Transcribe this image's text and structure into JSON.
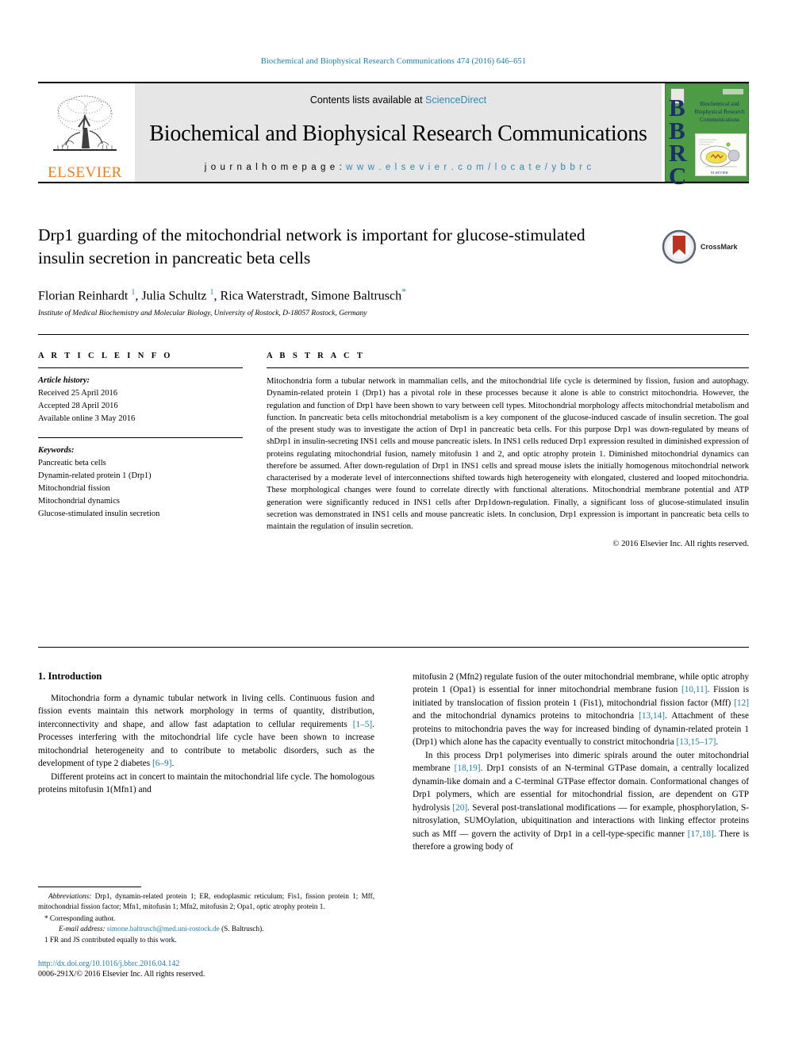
{
  "running_head": "Biochemical and Biophysical Research Communications 474 (2016) 646–651",
  "masthead": {
    "publisher": "ELSEVIER",
    "contents_prefix": "Contents lists available at ",
    "contents_link": "ScienceDirect",
    "journal_title": "Biochemical and Biophysical Research Communications",
    "homepage_prefix": "j o u r n a l  h o m e p a g e :  ",
    "homepage_url": "w w w . e l s e v i e r . c o m / l o c a t e / y b b r c",
    "cover": {
      "acronym": "BBRC",
      "title": "Biochemical and Biophysical Research Communications",
      "footer": "ELSEVIER"
    }
  },
  "article": {
    "title": "Drp1 guarding of the mitochondrial network is important for glucose-stimulated insulin secretion in pancreatic beta cells",
    "authors_html": "Florian Reinhardt, Julia Schultz, Rica Waterstradt, Simone Baltrusch",
    "author_list": [
      {
        "name": "Florian Reinhardt",
        "marks": [
          "1"
        ]
      },
      {
        "name": "Julia Schultz",
        "marks": [
          "1"
        ]
      },
      {
        "name": "Rica Waterstradt",
        "marks": []
      },
      {
        "name": "Simone Baltrusch",
        "marks": [
          "*"
        ]
      }
    ],
    "affiliation": "Institute of Medical Biochemistry and Molecular Biology, University of Rostock, D-18057 Rostock, Germany",
    "crossmark_label": "CrossMark"
  },
  "article_info": {
    "heading": "A R T I C L E   I N F O",
    "history_label": "Article history:",
    "history": [
      "Received 25 April 2016",
      "Accepted 28 April 2016",
      "Available online 3 May 2016"
    ],
    "keywords_label": "Keywords:",
    "keywords": [
      "Pancreatic beta cells",
      "Dynamin-related protein 1 (Drp1)",
      "Mitochondrial fission",
      "Mitochondrial dynamics",
      "Glucose-stimulated insulin secretion"
    ]
  },
  "abstract": {
    "heading": "A B S T R A C T",
    "text": "Mitochondria form a tubular network in mammalian cells, and the mitochondrial life cycle is determined by fission, fusion and autophagy. Dynamin-related protein 1 (Drp1) has a pivotal role in these processes because it alone is able to constrict mitochondria. However, the regulation and function of Drp1 have been shown to vary between cell types. Mitochondrial morphology affects mitochondrial metabolism and function. In pancreatic beta cells mitochondrial metabolism is a key component of the glucose-induced cascade of insulin secretion. The goal of the present study was to investigate the action of Drp1 in pancreatic beta cells. For this purpose Drp1 was down-regulated by means of shDrp1 in insulin-secreting INS1 cells and mouse pancreatic islets. In INS1 cells reduced Drp1 expression resulted in diminished expression of proteins regulating mitochondrial fusion, namely mitofusin 1 and 2, and optic atrophy protein 1. Diminished mitochondrial dynamics can therefore be assumed. After down-regulation of Drp1 in INS1 cells and spread mouse islets the initially homogenous mitochondrial network characterised by a moderate level of interconnections shifted towards high heterogeneity with elongated, clustered and looped mitochondria. These morphological changes were found to correlate directly with functional alterations. Mitochondrial membrane potential and ATP generation were significantly reduced in INS1 cells after Drp1down-regulation. Finally, a significant loss of glucose-stimulated insulin secretion was demonstrated in INS1 cells and mouse pancreatic islets. In conclusion, Drp1 expression is important in pancreatic beta cells to maintain the regulation of insulin secretion.",
    "copyright": "© 2016 Elsevier Inc. All rights reserved."
  },
  "introduction": {
    "heading": "1. Introduction",
    "left_p1_a": "Mitochondria form a dynamic tubular network in living cells. Continuous fusion and fission events maintain this network morphology in terms of quantity, distribution, interconnectivity and shape, and allow fast adaptation to cellular requirements ",
    "left_p1_ref1": "[1–5]",
    "left_p1_b": ". Processes interfering with the mitochondrial life cycle have been shown to increase mitochondrial heterogeneity and to contribute to metabolic disorders, such as the development of type 2 diabetes ",
    "left_p1_ref2": "[6–9]",
    "left_p1_c": ".",
    "left_p2": "Different proteins act in concert to maintain the mitochondrial life cycle. The homologous proteins mitofusin 1(Mfn1) and",
    "right_p1_a": "mitofusin 2 (Mfn2) regulate fusion of the outer mitochondrial membrane, while optic atrophy protein 1 (Opa1) is essential for inner mitochondrial membrane fusion ",
    "right_p1_ref1": "[10,11]",
    "right_p1_b": ". Fission is initiated by translocation of fission protein 1 (Fis1), mitochondrial fission factor (Mff) ",
    "right_p1_ref2": "[12]",
    "right_p1_c": " and the mitochondrial dynamics proteins to mitochondria ",
    "right_p1_ref3": "[13,14]",
    "right_p1_d": ". Attachment of these proteins to mitochondria paves the way for increased binding of dynamin-related protein 1 (Drp1) which alone has the capacity eventually to constrict mitochondria ",
    "right_p1_ref4": "[13,15–17]",
    "right_p1_e": ".",
    "right_p2_a": "In this process Drp1 polymerises into dimeric spirals around the outer mitochondrial membrane ",
    "right_p2_ref1": "[18,19]",
    "right_p2_b": ". Drp1 consists of an N-terminal GTPase domain, a centrally localized dynamin-like domain and a C-terminal GTPase effector domain. Conformational changes of Drp1 polymers, which are essential for mitochondrial fission, are dependent on GTP hydrolysis ",
    "right_p2_ref2": "[20]",
    "right_p2_c": ". Several post-translational modifications — for example, phosphorylation, S-nitrosylation, SUMOylation, ubiquitination and interactions with linking effector proteins such as Mff — govern the activity of Drp1 in a cell-type-specific manner ",
    "right_p2_ref3": "[17,18]",
    "right_p2_d": ". There is therefore a growing body of"
  },
  "footnotes": {
    "abbreviations_label": "Abbreviations:",
    "abbreviations_text": " Drp1, dynamin-related protein 1; ER, endoplasmic reticulum; Fis1, fission protein 1; Mff, mitochondrial fission factor; Mfn1, mitofusin 1; Mfn2, mitofusin 2; Opa1, optic atrophy protein 1.",
    "corresponding": "* Corresponding author.",
    "email_label": "E-mail address:",
    "email": "simone.baltrusch@med.uni-rostock.de",
    "email_suffix": " (S. Baltrusch).",
    "equal_contrib": "1 FR and JS contributed equally to this work.",
    "doi": "http://dx.doi.org/10.1016/j.bbrc.2016.04.142",
    "issn": "0006-291X/© 2016 Elsevier Inc. All rights reserved."
  },
  "colors": {
    "link": "#1a7fa8",
    "sciencedirect": "#2e8ab5",
    "elsevier_orange": "#ef7e1a",
    "cover_green": "#4e9b45",
    "cover_navy": "#1b2f6b",
    "crossmark_red": "#b9331f"
  }
}
